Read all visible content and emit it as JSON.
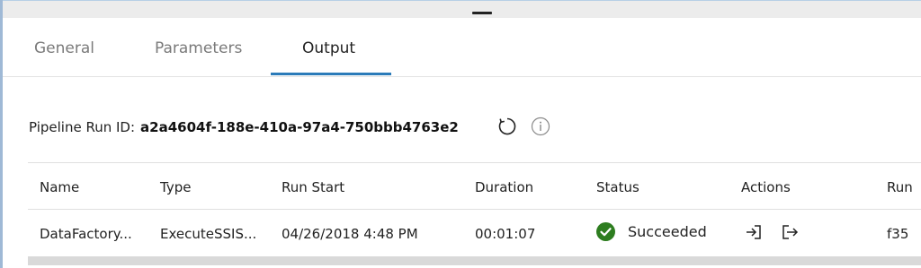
{
  "tabs": [
    {
      "label": "General",
      "active": false
    },
    {
      "label": "Parameters",
      "active": false
    },
    {
      "label": "Output",
      "active": true
    }
  ],
  "pipeline_run": {
    "label": "Pipeline Run ID:",
    "value": "a2a4604f-188e-410a-97a4-750bbb4763e2"
  },
  "icons": {
    "refresh": "refresh-icon",
    "info": "info-icon",
    "status": "check-circle-icon",
    "input": "input-icon",
    "output": "output-icon"
  },
  "table": {
    "columns": [
      "Name",
      "Type",
      "Run Start",
      "Duration",
      "Status",
      "Actions",
      "Run"
    ],
    "rows": [
      {
        "name": "DataFactory...",
        "type": "ExecuteSSIS...",
        "run_start": "04/26/2018 4:48 PM",
        "duration": "00:01:07",
        "status": "Succeeded",
        "run_id": "f35"
      }
    ]
  },
  "colors": {
    "accent": "#2b7bb9",
    "success": "#2d7d1f"
  }
}
